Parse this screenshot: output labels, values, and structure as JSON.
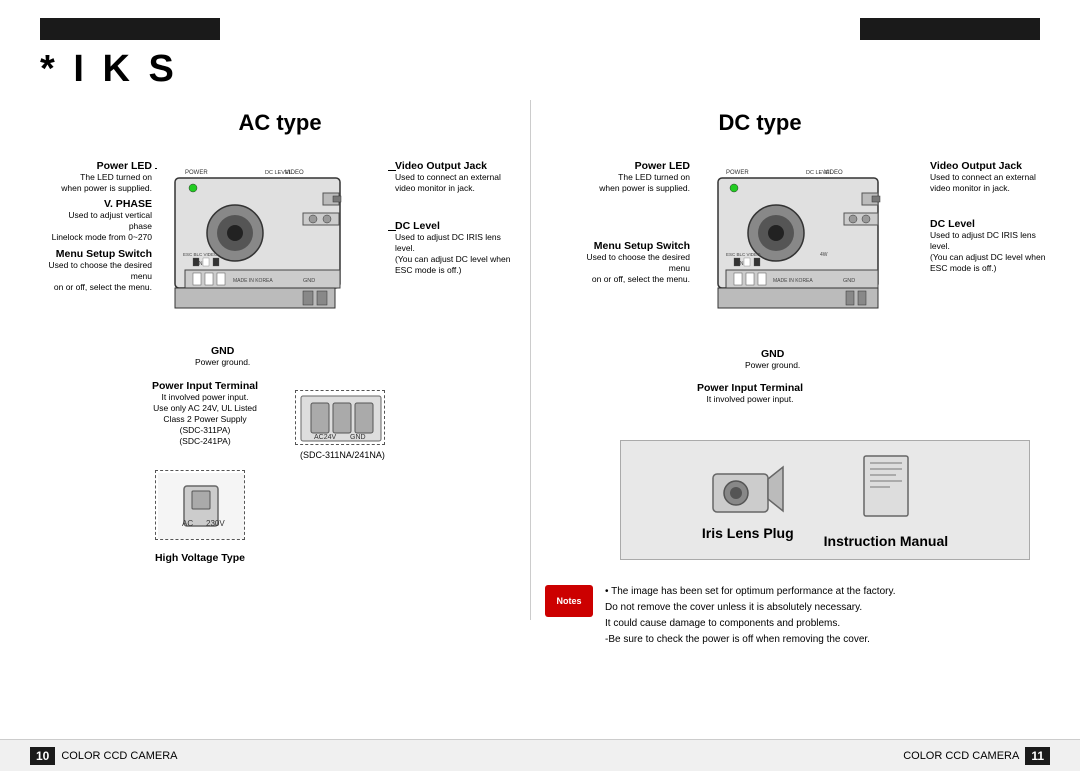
{
  "brand": "* I K S",
  "top_bars": {
    "left_bar": "",
    "right_bar": ""
  },
  "ac_section": {
    "title": "AC type",
    "labels_left": {
      "power_led": {
        "title": "Power LED",
        "desc": "The LED turned on\nwhen power is supplied."
      },
      "vphase": {
        "title": "V. PHASE",
        "desc": "Used to adjust vertical\nphase\nLinelock mode from 0~270"
      },
      "menu_setup": {
        "title": "Menu Setup Switch",
        "desc": "Used to choose the desired menu\non or off, select the menu."
      }
    },
    "labels_right": {
      "video_output": {
        "title": "Video Output Jack",
        "desc": "Used to connect an external\nvideo monitor in jack."
      },
      "dc_level": {
        "title": "DC Level",
        "desc": "Used to adjust DC IRIS lens level.\n(You can adjust DC level when\nESC mode is off.)"
      }
    },
    "gnd": {
      "title": "GND",
      "desc": "Power ground."
    },
    "power_input": {
      "title": "Power Input Terminal",
      "desc": "It involved power input.\nUse only AC 24V, UL Listed\nClass 2 Power Supply\n(SDC-311PA)\n(SDC-241PA)"
    },
    "sdc_note": "(SDC-311NA/241NA)",
    "high_voltage": {
      "label": "High Voltage Type",
      "ac_label": "AC",
      "voltage": "230V"
    }
  },
  "dc_section": {
    "title": "DC type",
    "labels_left": {
      "power_led": {
        "title": "Power LED",
        "desc": "The LED turned on\nwhen power is supplied."
      },
      "menu_setup": {
        "title": "Menu Setup Switch",
        "desc": "Used to choose the desired menu\non or off, select the menu."
      }
    },
    "labels_right": {
      "video_output": {
        "title": "Video Output Jack",
        "desc": "Used to connect an external\nvideo monitor in jack."
      },
      "dc_level": {
        "title": "DC Level",
        "desc": "Used to adjust DC IRIS lens level.\n(You can adjust DC level when\nESC mode is off.)"
      }
    },
    "gnd": {
      "title": "GND",
      "desc": "Power ground."
    },
    "power_input": {
      "title": "Power Input Terminal",
      "desc": "It involved power input."
    }
  },
  "accessories": {
    "iris_lens_plug": "Iris Lens Plug",
    "instruction_manual": "Instruction Manual"
  },
  "notes": {
    "badge": "Notes",
    "lines": [
      "• The image has been set for optimum performance at the factory.",
      "Do not remove the cover unless it is absolutely necessary.",
      "It could cause damage to components and problems.",
      "‐Be sure to check the power is off when removing the cover."
    ]
  },
  "footer": {
    "page_left": "10",
    "camera_left": "COLOR CCD CAMERA",
    "page_right": "11",
    "camera_right": "COLOR CCD CAMERA"
  }
}
